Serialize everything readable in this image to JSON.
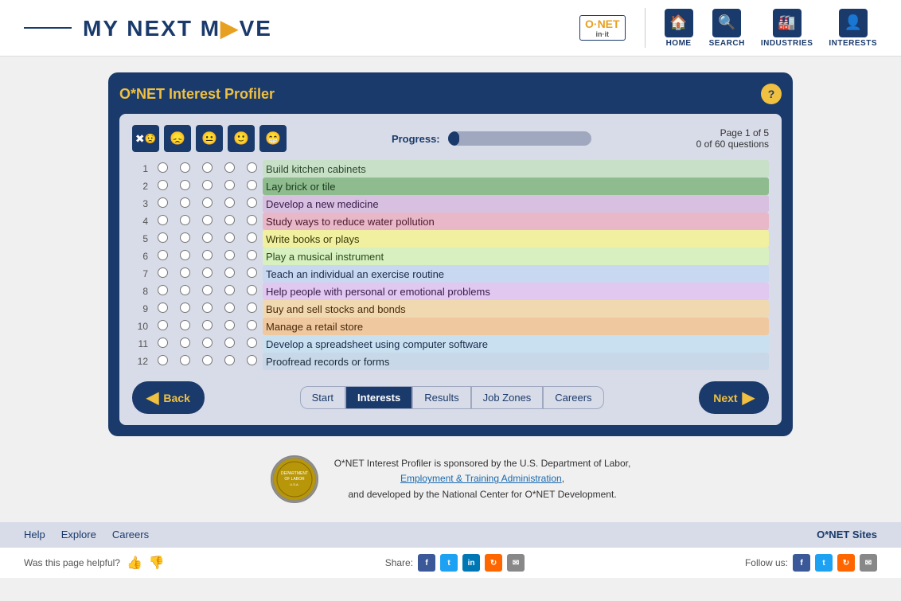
{
  "header": {
    "logo_prefix_line": "",
    "logo_text": "MY NEXT M",
    "logo_arrow": "▶",
    "logo_suffix": "VE",
    "onet_label": "O·NET",
    "onet_sub": "in·it",
    "nav": [
      {
        "icon": "🏠",
        "label": "HOME"
      },
      {
        "icon": "🔍",
        "label": "SEARCH"
      },
      {
        "icon": "🏭",
        "label": "INDUSTRIES"
      },
      {
        "icon": "👤",
        "label": "INTERESTS"
      }
    ]
  },
  "profiler": {
    "title": "O*NET Interest Profiler",
    "help_label": "?",
    "progress_label": "Progress:",
    "page_info": "Page 1 of 5",
    "question_info": "0 of 60 questions",
    "face_icons": [
      "😖",
      "😟",
      "😐",
      "🙂",
      "😁"
    ],
    "questions": [
      {
        "num": 1,
        "text": "Build kitchen cabinets"
      },
      {
        "num": 2,
        "text": "Lay brick or tile"
      },
      {
        "num": 3,
        "text": "Develop a new medicine"
      },
      {
        "num": 4,
        "text": "Study ways to reduce water pollution"
      },
      {
        "num": 5,
        "text": "Write books or plays"
      },
      {
        "num": 6,
        "text": "Play a musical instrument"
      },
      {
        "num": 7,
        "text": "Teach an individual an exercise routine"
      },
      {
        "num": 8,
        "text": "Help people with personal or emotional problems"
      },
      {
        "num": 9,
        "text": "Buy and sell stocks and bonds"
      },
      {
        "num": 10,
        "text": "Manage a retail store"
      },
      {
        "num": 11,
        "text": "Develop a spreadsheet using computer software"
      },
      {
        "num": 12,
        "text": "Proofread records or forms"
      }
    ],
    "nav_steps": [
      {
        "label": "Start",
        "active": false
      },
      {
        "label": "Interests",
        "active": true
      },
      {
        "label": "Results",
        "active": false
      },
      {
        "label": "Job Zones",
        "active": false
      },
      {
        "label": "Careers",
        "active": false
      }
    ],
    "back_label": "Back",
    "next_label": "Next"
  },
  "sponsor": {
    "text1": "O*NET Interest Profiler is sponsored by the U.S. Department of Labor,",
    "link_text": "Employment & Training Administration",
    "text2": ",",
    "text3": "and developed by the National Center for O*NET Development."
  },
  "footer_nav": {
    "links": [
      "Help",
      "Explore",
      "Careers"
    ],
    "right_label": "O*NET Sites"
  },
  "bottom_bar": {
    "helpful_text": "Was this page helpful?",
    "share_label": "Share:",
    "follow_label": "Follow us:"
  }
}
